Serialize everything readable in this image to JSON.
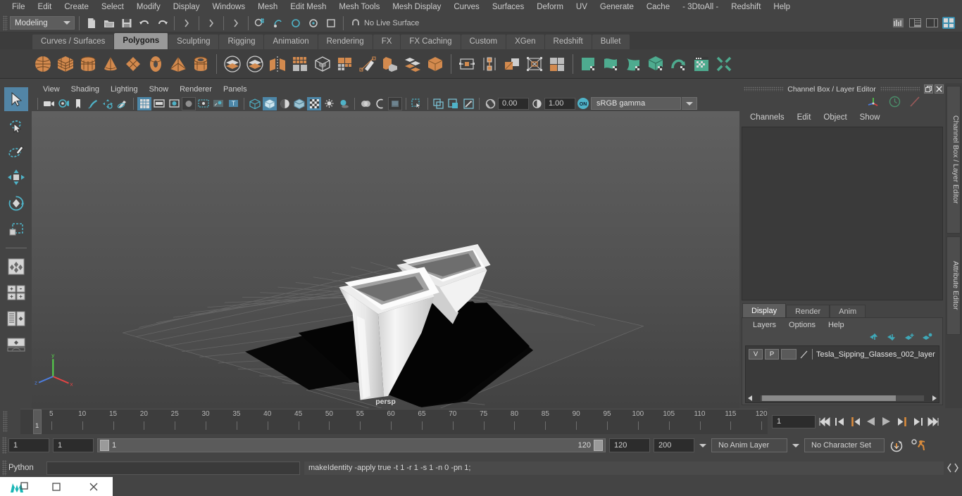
{
  "menubar": {
    "items": [
      "File",
      "Edit",
      "Create",
      "Select",
      "Modify",
      "Display",
      "Windows",
      "Mesh",
      "Edit Mesh",
      "Mesh Tools",
      "Mesh Display",
      "Curves",
      "Surfaces",
      "Deform",
      "UV",
      "Generate",
      "Cache",
      "- 3DtoAll -",
      "Redshift",
      "Help"
    ]
  },
  "statusline": {
    "mode": "Modeling",
    "live_surface": "No Live Surface"
  },
  "shelf": {
    "tabs": [
      "Curves / Surfaces",
      "Polygons",
      "Sculpting",
      "Rigging",
      "Animation",
      "Rendering",
      "FX",
      "FX Caching",
      "Custom",
      "XGen",
      "Redshift",
      "Bullet"
    ],
    "active_tab": "Polygons",
    "icons": [
      "poly-sphere-icon",
      "poly-cube-icon",
      "poly-cylinder-icon",
      "poly-cone-icon",
      "poly-plane-icon",
      "poly-torus-icon",
      "poly-pyramid-icon",
      "poly-pipe-icon",
      "combine-icon",
      "separate-icon",
      "mirror-icon",
      "smooth-icon",
      "booleans-icon",
      "multi-cut-icon",
      "extrude-icon",
      "bevel-icon",
      "bridge-icon",
      "append-polygon-icon",
      "target-weld-icon",
      "connect-icon",
      "crease-icon",
      "quad-draw-icon",
      "uv-editor-icon",
      "uv-planar-icon",
      "uv-cylindrical-icon",
      "uv-spherical-icon",
      "uv-automatic-icon",
      "uv-unfold-icon",
      "uv-layout-icon",
      "uv-cut-icon"
    ]
  },
  "toolbox": {
    "items": [
      "select-tool",
      "lasso-select-tool",
      "paint-select-tool",
      "move-tool",
      "rotate-tool",
      "scale-tool",
      "last-tool",
      "layout-quad-icon",
      "layout-2-panes-icon",
      "layout-persp-outliner-icon",
      "layout-hypergraph-icon",
      "maya-logo-icon"
    ],
    "active": "select-tool"
  },
  "viewport": {
    "menus": [
      "View",
      "Shading",
      "Lighting",
      "Show",
      "Renderer",
      "Panels"
    ],
    "exposure": "0.00",
    "gamma": "1.00",
    "color_space": "sRGB gamma",
    "camera_label": "persp",
    "toolbar_icons": [
      "camera-icon",
      "camera-attributes-icon",
      "bookmark-icon",
      "image-plane-icon",
      "2d-pan-zoom-icon",
      "grease-pencil-icon",
      "grid-toggle-icon",
      "film-gate-icon",
      "resolution-gate-icon",
      "gate-mask-icon",
      "xray-icon",
      "xray-joints-icon",
      "texture-toggle-icon",
      "wireframe-icon",
      "smooth-shade-icon",
      "textured-icon",
      "light-icon",
      "shadows-icon",
      "screen-space-ao-icon",
      "motion-blur-icon",
      "multisample-icon",
      "depth-of-field-icon",
      "isolate-select-icon",
      "display-layer-icon",
      "panel-zoom-icon",
      "snapshot-icon",
      "exposure-icon",
      "gamma-icon"
    ]
  },
  "right_panel": {
    "title": "Channel Box / Layer Editor",
    "channel_menus": [
      "Channels",
      "Edit",
      "Object",
      "Show"
    ],
    "layer_tabs": [
      "Display",
      "Render",
      "Anim"
    ],
    "layer_tab_active": "Display",
    "layer_menus": [
      "Layers",
      "Options",
      "Help"
    ],
    "layers": [
      {
        "v": "V",
        "p": "P",
        "color": "",
        "name": "Tesla_Sipping_Glasses_002_layer"
      }
    ],
    "vertical_tabs": [
      "Channel Box / Layer Editor",
      "Attribute Editor"
    ],
    "header_icons": [
      "axis-gizmo-icon",
      "clock-icon",
      "pencil-icon"
    ],
    "window_buttons": [
      "restore-icon",
      "close-icon"
    ]
  },
  "timeline": {
    "ticks": [
      5,
      10,
      15,
      20,
      25,
      30,
      35,
      40,
      45,
      50,
      55,
      60,
      65,
      70,
      75,
      80,
      85,
      90,
      95,
      100,
      105,
      110,
      115,
      120
    ],
    "current_frame_marker": "1",
    "current_frame_field": "1",
    "playback_buttons": [
      "go-to-start-icon",
      "step-back-keyframe-icon",
      "step-back-frame-icon",
      "play-backwards-icon",
      "play-forwards-icon",
      "step-forward-frame-icon",
      "step-forward-keyframe-icon",
      "go-to-end-icon"
    ]
  },
  "range_bar": {
    "anim_start": "1",
    "range_start": "1",
    "slider_min_label": "1",
    "slider_max_label": "120",
    "range_end": "120",
    "anim_end": "200",
    "anim_layer": "No Anim Layer",
    "character_set": "No Character Set",
    "right_icons": [
      "auto-keyframe-icon",
      "animation-preferences-icon"
    ]
  },
  "command_line": {
    "language": "Python",
    "input_value": "",
    "output": "makeIdentity -apply true -t 1 -r 1 -s 1 -n 0 -pn 1;",
    "script-editor-icon": "script-editor-icon"
  },
  "taskbar": {
    "items": [
      "maya-app-icon",
      "maximize-icon",
      "close-icon"
    ]
  },
  "colors": {
    "accent_blue": "#4d87a8",
    "shelf_orange": "#d38a4e",
    "shelf_green": "#4eab8f",
    "bg_dark": "#444444",
    "panel_dark": "#3a3a3a"
  }
}
